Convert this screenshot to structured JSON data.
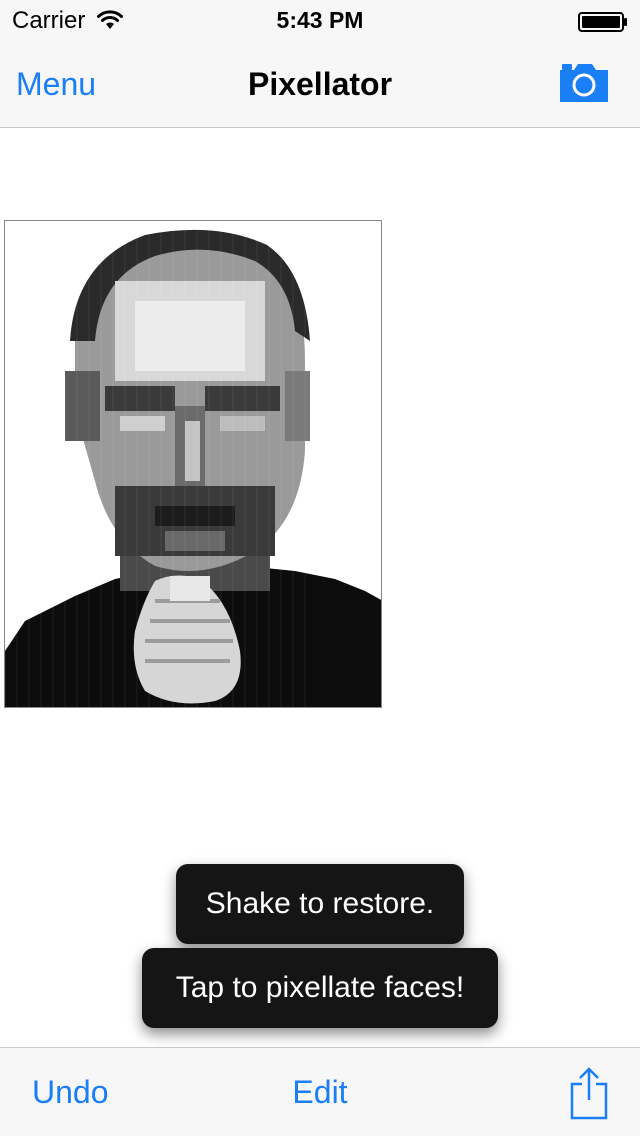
{
  "status_bar": {
    "carrier": "Carrier",
    "time": "5:43 PM",
    "wifi_icon": "wifi-icon",
    "battery_icon": "battery-full-icon"
  },
  "nav_bar": {
    "left_button": "Menu",
    "title": "Pixellator",
    "right_icon": "camera-icon"
  },
  "photo": {
    "description_icon": "pixellated-portrait-image"
  },
  "toasts": [
    {
      "text": "Shake to restore."
    },
    {
      "text": "Tap to pixellate faces!"
    }
  ],
  "toolbar": {
    "undo_label": "Undo",
    "edit_label": "Edit",
    "share_icon": "share-icon"
  },
  "colors": {
    "accent": "#1a7ef5",
    "bar_background": "#f7f7f8",
    "toast_background": "#151515"
  }
}
